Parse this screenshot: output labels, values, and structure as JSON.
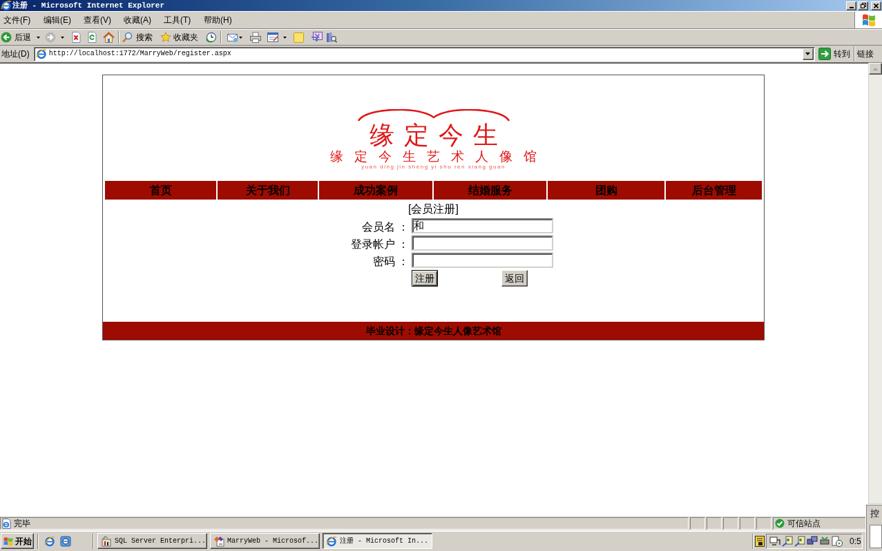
{
  "window": {
    "title": "注册 - Microsoft Internet Explorer"
  },
  "menu": [
    "文件(F)",
    "编辑(E)",
    "查看(V)",
    "收藏(A)",
    "工具(T)",
    "帮助(H)"
  ],
  "toolbar": {
    "back": "后退",
    "search": "搜索",
    "favorites": "收藏夹"
  },
  "address_bar": {
    "label": "地址(D)",
    "url": "http://localhost:1772/MarryWeb/register.aspx",
    "go": "转到",
    "links": "链接"
  },
  "page": {
    "logo": {
      "title": "缘定今生",
      "subtitle": "缘定今生艺术人像馆",
      "pinyin": "yuan ding jin sheng yi shu ren xiang guan"
    },
    "nav": [
      "首页",
      "关于我们",
      "成功案例",
      "结婚服务",
      "团购",
      "后台管理"
    ],
    "form": {
      "heading": "[会员注册]",
      "fields": [
        {
          "label": "会员名 ：",
          "value": "和"
        },
        {
          "label": "登录帐户 ："
        },
        {
          "label": "密码 ："
        }
      ],
      "buttons": [
        {
          "label": "注册",
          "focused": true
        },
        {
          "label": "返回",
          "focused": false
        }
      ]
    },
    "footer": "毕业设计：缘定今生人像艺术馆"
  },
  "status_bar": {
    "text": "完毕",
    "zone": "可信站点"
  },
  "taskbar": {
    "start": "开始",
    "tasks": [
      {
        "label": "SQL Server Enterpri...",
        "selected": false
      },
      {
        "label": "MarryWeb - Microsof...",
        "selected": false
      },
      {
        "label": "注册 - Microsoft In...",
        "selected": true
      }
    ],
    "clock": "0:5"
  },
  "side_window": {
    "title": "控"
  }
}
